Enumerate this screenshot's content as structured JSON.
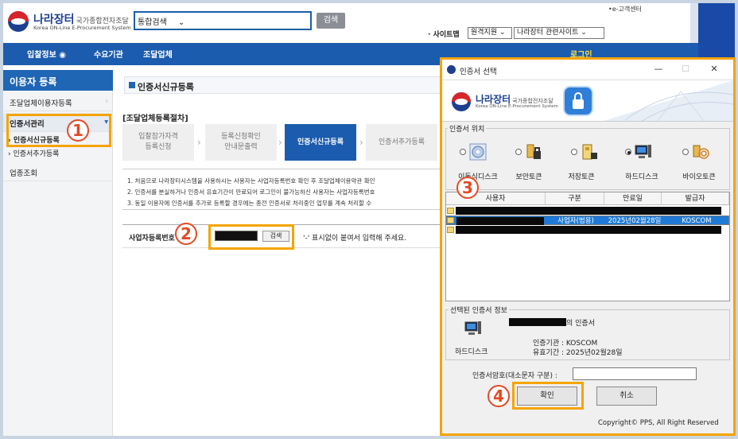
{
  "brand": {
    "name_ko": "나라장터",
    "tagline_ko": "국가종합전자조달",
    "name_en": "Korea ON-Line E-Procurement System"
  },
  "header": {
    "search_select": "통합검색",
    "search_button": "검색",
    "top_link": "•e-고객센터",
    "sitemap_label": "· 사이트맵",
    "site_select_1": "원격지원",
    "site_select_2": "나라장터 관련사이트"
  },
  "nav": {
    "items": [
      "입찰정보",
      "수요기관",
      "조달업체"
    ],
    "login": "로그인"
  },
  "sidebar": {
    "title": "이용자 등록",
    "items": [
      "조달업체이용자등록",
      "인증서관리",
      "업종조회"
    ],
    "sub_items": [
      "› 인증서신규등록",
      "› 인증서추가등록"
    ]
  },
  "main": {
    "page_title": "인증서신규등록",
    "procedure_title": "[조달업체등록절차]",
    "steps": [
      "입찰참가자격\n등록신청",
      "등록신청확인\n안내문출력",
      "인증서신규등록",
      "인증서추가등록"
    ],
    "notices": [
      "1. 처음으로 나라장터시스템을 사용하시는 사용자는 사업자등록번호 확인 후 조달업체이용약관 확인",
      "2. 인증서를 분실하거나 인증서 유효기간이 만료되어 로그인이 불가능하신 사용자는 사업자등록번호",
      "3. 동일 이용자에 인증서를 추가로 등록할 경우에는 종전 인증서로 처리중인 업무를 계속 처리할 수"
    ],
    "biz_label": "사업자등록번호",
    "biz_search_button": "검색",
    "biz_note": "'-' 표시없이 붙여서 입력해 주세요."
  },
  "markers": [
    "1",
    "2",
    "3",
    "4"
  ],
  "dialog": {
    "title": "인증서 선택",
    "window_buttons": [
      "—",
      "☐",
      "✕"
    ],
    "location_legend": "인증서 위치",
    "locations": [
      "이동식디스크",
      "보안토큰",
      "저장토큰",
      "하드디스크",
      "바이오토큰"
    ],
    "selected_location": "하드디스크",
    "columns": [
      "사용자",
      "구분",
      "만료일",
      "발급자"
    ],
    "selected_row": {
      "type": "사업자(범용)",
      "expiry": "2025년02월28일",
      "issuer": "KOSCOM"
    },
    "selected_info_legend": "선택된 인증서 정보",
    "selected_info_suffix": "의 인증서",
    "selected_info_device": "하드디스크",
    "issuer_line": "인증기관 : KOSCOM",
    "validity_line": "유효기간 : 2025년02월28일",
    "password_label": "인증서암호(대소문자 구분) :",
    "confirm_button": "확인",
    "cancel_button": "취소",
    "copyright": "Copyright© PPS, All Right Reserved"
  },
  "colors": {
    "brand_blue": "#1c5cae",
    "highlight_orange": "#f5a400",
    "marker_red": "#e34a27",
    "selection_blue": "#1e7ad6"
  }
}
